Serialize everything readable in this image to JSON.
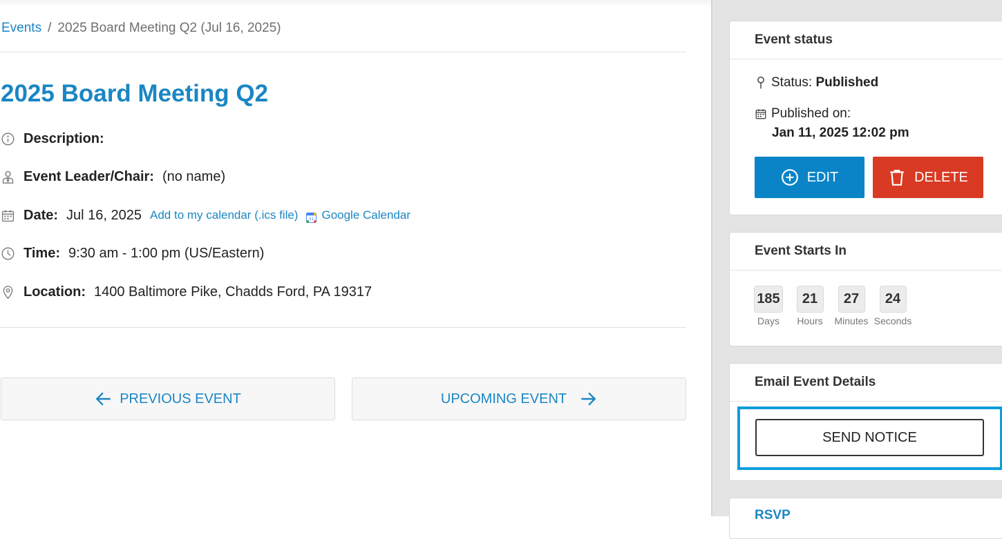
{
  "breadcrumb": {
    "root": "Events",
    "separator": "/",
    "current": "2025 Board Meeting Q2 (Jul 16, 2025)"
  },
  "event": {
    "title": "2025 Board Meeting Q2",
    "description_label": "Description:",
    "leader_label": "Event Leader/Chair:",
    "leader_value": "(no name)",
    "date_label": "Date:",
    "date_value": "Jul 16, 2025",
    "ics_link": "Add to my calendar (.ics file)",
    "google_link": "Google Calendar",
    "time_label": "Time:",
    "time_value": "9:30 am - 1:00 pm (US/Eastern)",
    "location_label": "Location:",
    "location_value": "1400 Baltimore Pike, Chadds Ford, PA 19317"
  },
  "nav": {
    "previous": "PREVIOUS EVENT",
    "upcoming": "UPCOMING EVENT"
  },
  "status_card": {
    "title": "Event status",
    "status_label": "Status:",
    "status_value": "Published",
    "published_label": "Published on:",
    "published_value": "Jan 11, 2025 12:02 pm",
    "edit": "EDIT",
    "delete": "DELETE"
  },
  "countdown_card": {
    "title": "Event Starts In",
    "items": [
      {
        "value": "185",
        "unit": "Days"
      },
      {
        "value": "21",
        "unit": "Hours"
      },
      {
        "value": "27",
        "unit": "Minutes"
      },
      {
        "value": "24",
        "unit": "Seconds"
      }
    ]
  },
  "email_card": {
    "title": "Email Event Details",
    "send": "SEND NOTICE"
  },
  "rsvp_card": {
    "title": "RSVP"
  },
  "colors": {
    "accent": "#1a86c4",
    "edit": "#0a84c6",
    "delete": "#d93a23",
    "highlight": "#0d9ddb"
  }
}
